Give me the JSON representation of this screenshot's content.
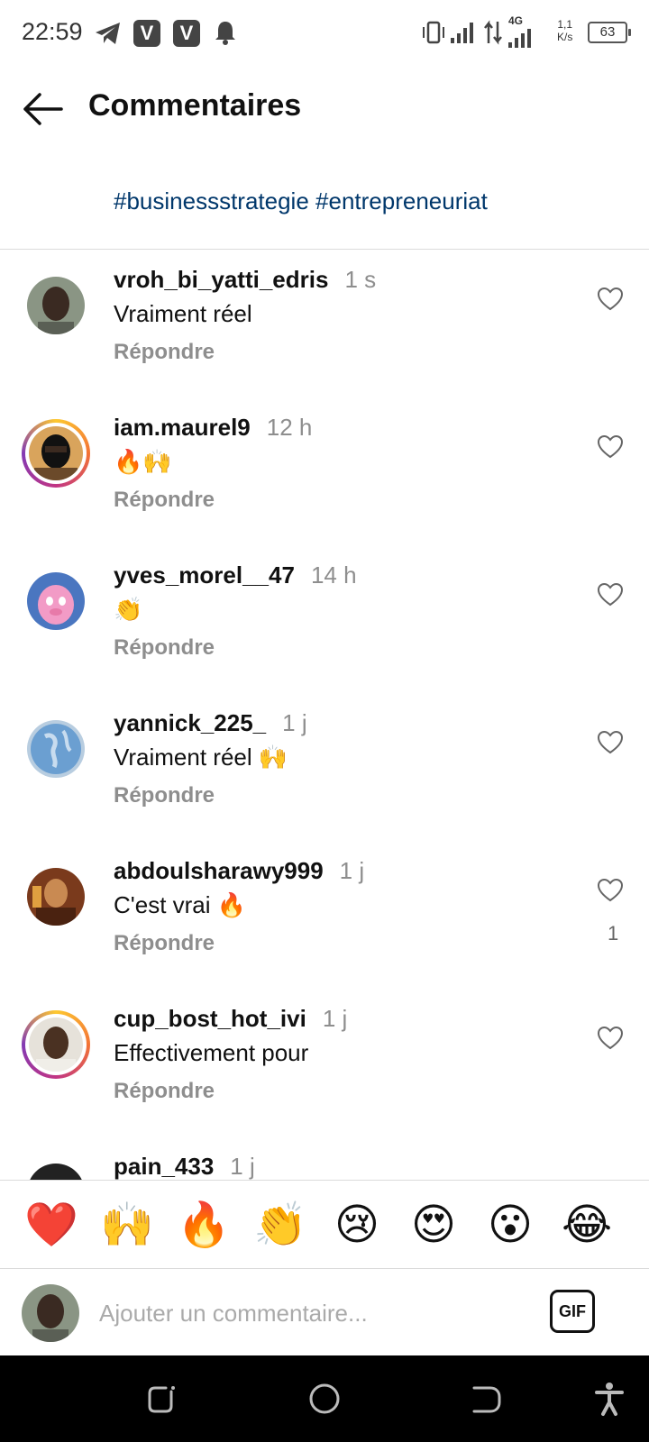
{
  "status_bar": {
    "time": "22:59",
    "network": "4G",
    "speed_value": "1,1",
    "speed_unit": "K/s",
    "battery": "63",
    "icons": [
      "telegram-icon",
      "v-app-icon",
      "v-app-icon",
      "bell-icon",
      "vibrate-icon",
      "signal-icon",
      "data-arrows-icon",
      "signal-4g-icon"
    ]
  },
  "header": {
    "title": "Commentaires"
  },
  "caption": "#businessstrategie #entrepreneuriat",
  "comments": [
    {
      "username": "vroh_bi_yatti_edris",
      "time": "1 s",
      "text": "Vraiment réel",
      "reply": "Répondre",
      "likes": "",
      "story": false
    },
    {
      "username": "iam.maurel9",
      "time": "12 h",
      "text": "🔥🙌",
      "reply": "Répondre",
      "likes": "",
      "story": true
    },
    {
      "username": "yves_morel__47",
      "time": "14 h",
      "text": "👏",
      "reply": "Répondre",
      "likes": "",
      "story": false
    },
    {
      "username": "yannick_225_",
      "time": "1 j",
      "text": "Vraiment réel 🙌",
      "reply": "Répondre",
      "likes": "",
      "story": false
    },
    {
      "username": "abdoulsharawy999",
      "time": "1 j",
      "text": "C'est vrai 🔥",
      "reply": "Répondre",
      "likes": "1",
      "story": false
    },
    {
      "username": "cup_bost_hot_ivi",
      "time": "1 j",
      "text": "Effectivement pour",
      "reply": "Répondre",
      "likes": "",
      "story": true
    },
    {
      "username": "pain_433",
      "time": "1 j",
      "text": "",
      "reply": "",
      "likes": "",
      "story": false
    }
  ],
  "reactions": [
    "❤️",
    "🙌",
    "🔥",
    "👏",
    "😢",
    "😍",
    "😮",
    "😂"
  ],
  "compose": {
    "placeholder": "Ajouter un commentaire...",
    "gif_label": "GIF"
  },
  "colors": {
    "link": "#00376b",
    "muted": "#8e8e8e",
    "story_ring": [
      "#fdc830",
      "#f37335",
      "#c13584",
      "#833ab4"
    ]
  }
}
